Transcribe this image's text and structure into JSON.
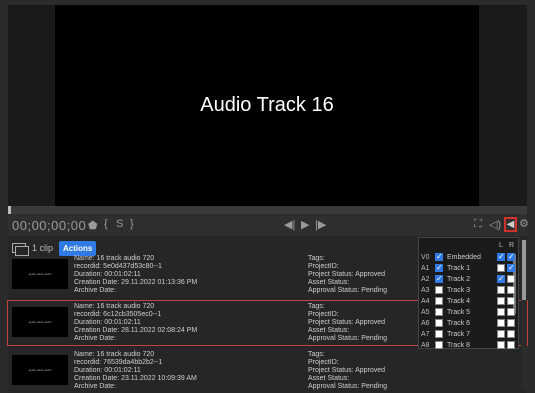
{
  "player": {
    "title": "Audio Track 16"
  },
  "controls": {
    "timecode": "00;00;00;00",
    "icons": [
      "mark-in-icon",
      "brace-open-icon",
      "segment-icon",
      "brace-close-icon",
      "step-back-icon",
      "play-icon",
      "step-forward-icon",
      "fullscreen-icon",
      "volume-icon",
      "audio-routing-icon",
      "settings-icon"
    ]
  },
  "list": {
    "clip_count": "1 clip",
    "actions_label": "Actions",
    "rows": [
      {
        "name": "Name: 16 track audio 720",
        "recordid": "recordid: 5e0d437d53c80--1",
        "duration": "Duration: 00:01:02:11",
        "created": "Creation Date: 29.11.2022 01:13:36 PM",
        "archive": "Archive Date:",
        "tags": "Tags:",
        "project": "ProjectID:",
        "project_status": "Project Status: Approved",
        "asset_status": "Asset Status:",
        "approval": "Approval Status: Pending",
        "thumb": "audio track audio",
        "selected": false
      },
      {
        "name": "Name: 16 track audio 720",
        "recordid": "recordid: 6c12cb3505ec0--1",
        "duration": "Duration: 00:01:02:11",
        "created": "Creation Date: 28.11.2022 02:08:24 PM",
        "archive": "Archive Date:",
        "tags": "Tags:",
        "project": "ProjectID:",
        "project_status": "Project Status: Approved",
        "asset_status": "Asset Status:",
        "approval": "Approval Status: Pending",
        "thumb": "audio track audio",
        "selected": true
      },
      {
        "name": "Name: 16 track audio 720",
        "recordid": "recordid: 76539da4bb2b2--1",
        "duration": "Duration: 00:01:02:11",
        "created": "Creation Date: 23.11.2022 10:09:39 AM",
        "archive": "Archive Date:",
        "tags": "Tags:",
        "project": "ProjectID:",
        "project_status": "Project Status: Approved",
        "asset_status": "Asset Status:",
        "approval": "Approval Status: Pending",
        "thumb": "audio track audio",
        "selected": false
      }
    ]
  },
  "audio_dropdown": {
    "header_l": "L",
    "header_r": "R",
    "tracks": [
      {
        "ch": "V0",
        "on": true,
        "name": "Embedded",
        "l": true,
        "r": true
      },
      {
        "ch": "A1",
        "on": true,
        "name": "Track 1",
        "l": false,
        "r": true
      },
      {
        "ch": "A2",
        "on": true,
        "name": "Track 2",
        "l": true,
        "r": false
      },
      {
        "ch": "A3",
        "on": false,
        "name": "Track 3",
        "l": false,
        "r": false
      },
      {
        "ch": "A4",
        "on": false,
        "name": "Track 4",
        "l": false,
        "r": false
      },
      {
        "ch": "A5",
        "on": false,
        "name": "Track 5",
        "l": false,
        "r": false
      },
      {
        "ch": "A6",
        "on": false,
        "name": "Track 6",
        "l": false,
        "r": false
      },
      {
        "ch": "A7",
        "on": false,
        "name": "Track 7",
        "l": false,
        "r": false
      },
      {
        "ch": "A8",
        "on": false,
        "name": "Track 8",
        "l": false,
        "r": false
      }
    ]
  },
  "colors": {
    "accent": "#2f7ae5",
    "selection": "#c0433e"
  }
}
